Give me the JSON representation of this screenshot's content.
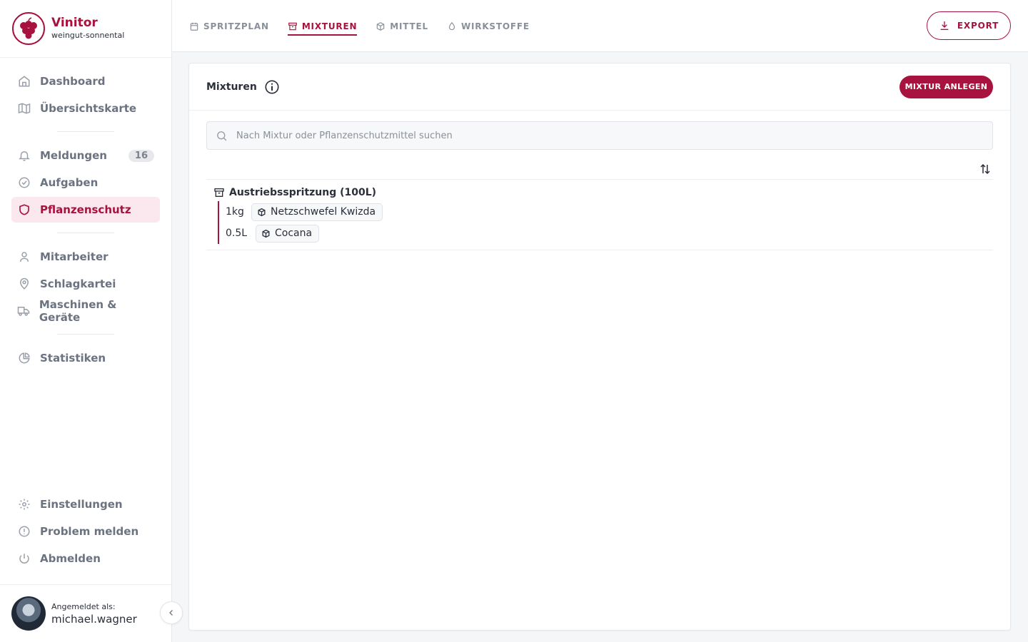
{
  "brand": {
    "name": "Vinitor",
    "subtitle": "weingut-sonnental"
  },
  "sidebar": {
    "groups": [
      [
        {
          "label": "Dashboard",
          "icon": "home-icon"
        },
        {
          "label": "Übersichtskarte",
          "icon": "map-icon"
        }
      ],
      [
        {
          "label": "Meldungen",
          "icon": "bell-icon",
          "badge": "16"
        },
        {
          "label": "Aufgaben",
          "icon": "check-circle-icon"
        },
        {
          "label": "Pflanzenschutz",
          "icon": "shield-icon",
          "active": true
        }
      ],
      [
        {
          "label": "Mitarbeiter",
          "icon": "user-icon"
        },
        {
          "label": "Schlagkartei",
          "icon": "map-pin-icon"
        },
        {
          "label": "Maschinen & Geräte",
          "icon": "truck-icon"
        }
      ],
      [
        {
          "label": "Statistiken",
          "icon": "pie-chart-icon"
        }
      ]
    ],
    "bottom": [
      {
        "label": "Einstellungen",
        "icon": "gear-icon"
      },
      {
        "label": "Problem melden",
        "icon": "alert-circle-icon"
      },
      {
        "label": "Abmelden",
        "icon": "power-icon"
      }
    ]
  },
  "user": {
    "label": "Angemeldet als:",
    "name": "michael.wagner"
  },
  "topbar": {
    "tabs": [
      {
        "label": "SPRITZPLAN",
        "icon": "calendar-icon"
      },
      {
        "label": "MIXTUREN",
        "icon": "archive-icon",
        "active": true
      },
      {
        "label": "MITTEL",
        "icon": "box-icon"
      },
      {
        "label": "WIRKSTOFFE",
        "icon": "droplet-icon"
      }
    ],
    "export_label": "EXPORT"
  },
  "main": {
    "title": "Mixturen",
    "add_label": "MIXTUR ANLEGEN",
    "search_placeholder": "Nach Mixtur oder Pflanzenschutzmittel suchen",
    "mixtures": [
      {
        "name": "Austriebsspritzung (100L)",
        "items": [
          {
            "amount": "1kg",
            "product": "Netzschwefel Kwizda"
          },
          {
            "amount": "0.5L",
            "product": "Cocana"
          }
        ]
      }
    ]
  },
  "colors": {
    "accent": "#a8123e",
    "accent_light": "#fbe8ee"
  }
}
